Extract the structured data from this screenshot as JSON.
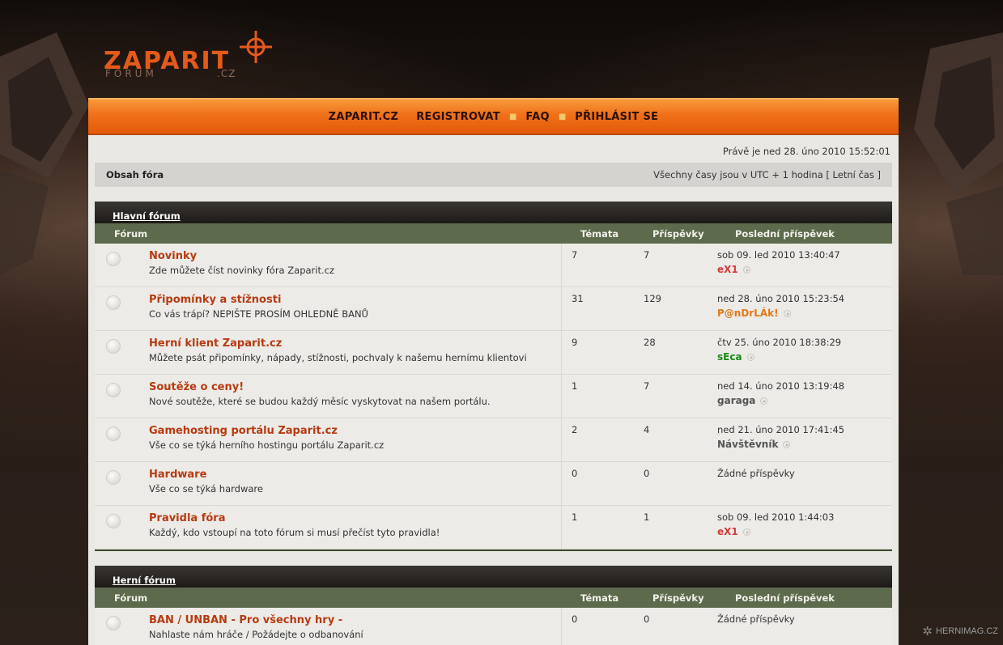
{
  "logo": {
    "main": "ZAPARIT",
    "sub": "FORUM",
    "tld": ".CZ"
  },
  "nav": {
    "items": [
      "ZAPARIT.CZ",
      "REGISTROVAT",
      "FAQ",
      "PŘIHLÁSIT SE"
    ]
  },
  "date_line": "Právě je ned 28. úno 2010 15:52:01",
  "crumbbar": {
    "crumb": "Obsah fóra",
    "timezone": "Všechny časy jsou v UTC + 1 hodina [ Letní čas ]"
  },
  "columns": {
    "forum": "Fórum",
    "topics": "Témata",
    "posts": "Příspěvky",
    "last": "Poslední příspěvek"
  },
  "categories": [
    {
      "name": "Hlavní fórum",
      "forums": [
        {
          "title": "Novinky",
          "desc": "Zde můžete číst novinky fóra Zaparit.cz",
          "topics": "7",
          "posts": "7",
          "last_date": "sob 09. led 2010 13:40:47",
          "last_user": "eX1",
          "user_color": "#d43a3a"
        },
        {
          "title": "Připomínky a stížnosti",
          "desc": "Co vás trápí? NEPIŠTE PROSÍM OHLEDNĚ BANŮ",
          "topics": "31",
          "posts": "129",
          "last_date": "ned 28. úno 2010 15:23:54",
          "last_user": "P@nDrLÁk!",
          "user_color": "#e07a1a"
        },
        {
          "title": "Herní klient Zaparit.cz",
          "desc": "Můžete psát připomínky, nápady, stížnosti, pochvaly k našemu hernímu klientovi",
          "topics": "9",
          "posts": "28",
          "last_date": "čtv 25. úno 2010 18:38:29",
          "last_user": "sEca",
          "user_color": "#1a8a1a"
        },
        {
          "title": "Soutěže o ceny!",
          "desc": "Nové soutěže, které se budou každý měsíc vyskytovat na našem portálu.",
          "topics": "1",
          "posts": "7",
          "last_date": "ned 14. úno 2010 13:19:48",
          "last_user": "garaga",
          "user_color": "#555555"
        },
        {
          "title": "Gamehosting portálu Zaparit.cz",
          "desc": "Vše co se týká herního hostingu portálu Zaparit.cz",
          "topics": "2",
          "posts": "4",
          "last_date": "ned 21. úno 2010 17:41:45",
          "last_user": "Návštěvník",
          "user_color": "#555555"
        },
        {
          "title": "Hardware",
          "desc": "Vše co se týká hardware",
          "topics": "0",
          "posts": "0",
          "last_date": "Žádné příspěvky",
          "last_user": "",
          "user_color": "#555555"
        },
        {
          "title": "Pravidla fóra",
          "desc": "Každý, kdo vstoupí na toto fórum si musí přečíst tyto pravidla!",
          "topics": "1",
          "posts": "1",
          "last_date": "sob 09. led 2010 1:44:03",
          "last_user": "eX1",
          "user_color": "#d43a3a"
        }
      ]
    },
    {
      "name": "Herní fórum",
      "forums": [
        {
          "title": "BAN / UNBAN - Pro všechny hry -",
          "desc": "Nahlaste nám hráče / Požádejte o odbanování",
          "topics": "0",
          "posts": "0",
          "last_date": "Žádné příspěvky",
          "last_user": "",
          "user_color": "#555555"
        }
      ]
    }
  ],
  "watermark": "HERNIMAG.CZ",
  "colors": {
    "accent": "#f0701a",
    "forum_title": "#b83a10",
    "column_header": "#5e6a4c"
  }
}
